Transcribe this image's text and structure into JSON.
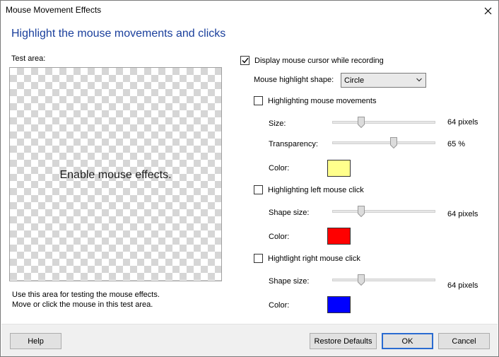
{
  "window": {
    "title": "Mouse Movement Effects"
  },
  "heading": "Highlight the mouse movements and clicks",
  "test_area": {
    "label": "Test area:",
    "center_text": "Enable mouse effects.",
    "hint_line1": "Use this area for testing the mouse effects.",
    "hint_line2": "Move or click the mouse in this test area."
  },
  "display_cursor": {
    "label": "Display mouse cursor while recording",
    "checked": true
  },
  "highlight_shape": {
    "label": "Mouse highlight shape:",
    "value": "Circle"
  },
  "movements": {
    "label": "Highlighting mouse movements",
    "checked": false,
    "size_label": "Size:",
    "size_value": "64 pixels",
    "transparency_label": "Transparency:",
    "transparency_value": "65 %",
    "color_label": "Color:",
    "color": "#ffff8c"
  },
  "left_click": {
    "label": "Highlighting left mouse click",
    "checked": false,
    "size_label": "Shape size:",
    "size_value": "64 pixels",
    "color_label": "Color:",
    "color": "#ff0000"
  },
  "right_click": {
    "label": "Hightlight right mouse click",
    "checked": false,
    "size_label": "Shape size:",
    "size_value": "64 pixels",
    "color_label": "Color:",
    "color": "#0000ff"
  },
  "buttons": {
    "help": "Help",
    "restore": "Restore Defaults",
    "ok": "OK",
    "cancel": "Cancel"
  }
}
